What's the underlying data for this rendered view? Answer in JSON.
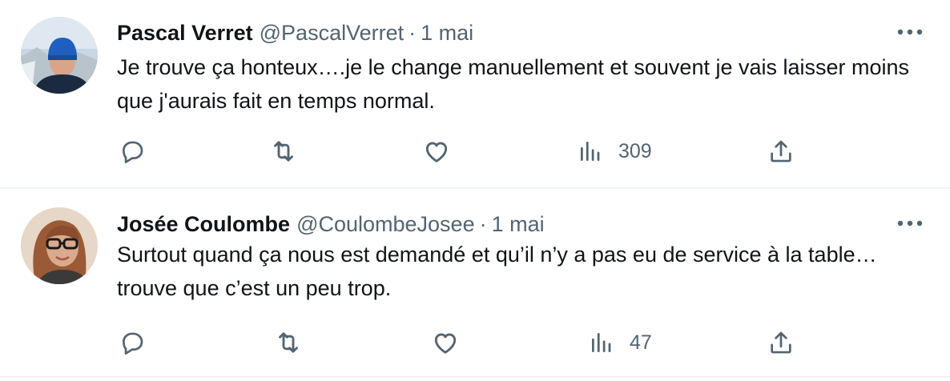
{
  "tweets": [
    {
      "display_name": "Pascal Verret",
      "handle": "@PascalVerret",
      "separator": "·",
      "date": "1 mai",
      "text": "Je trouve ça honteux….je le change manuellement et souvent je vais laisser moins que j'aurais fait en temps normal.",
      "views": "309",
      "avatar_icon": "profile-photo"
    },
    {
      "display_name": "Josée Coulombe",
      "handle": "@CoulombeJosee",
      "separator": "·",
      "date": "1 mai",
      "text": "Surtout quand ça nous est demandé et qu’il n’y a pas eu de service à la table… trouve que c’est un peu trop.",
      "views": "47",
      "avatar_icon": "profile-photo"
    }
  ],
  "icons": {
    "reply": "reply-icon",
    "retweet": "retweet-icon",
    "like": "like-icon",
    "views": "views-icon",
    "share": "share-icon",
    "more": "more-icon"
  },
  "colors": {
    "text": "#0f1419",
    "muted": "#536471",
    "divider": "#eff3f4"
  }
}
